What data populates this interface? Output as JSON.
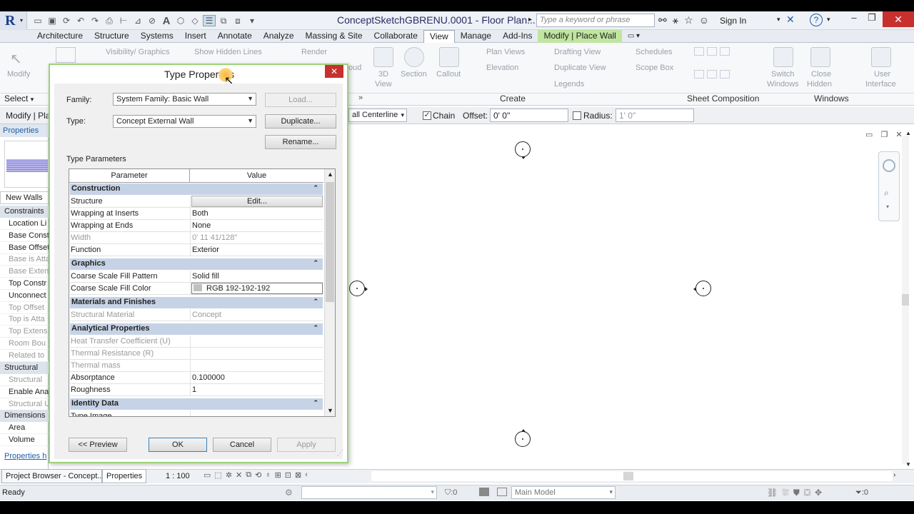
{
  "app": {
    "doc_title": "ConceptSketchGBRENU.0001 - Floor Plan...",
    "search_placeholder": "Type a keyword or phrase",
    "signin": "Sign In"
  },
  "tabs": [
    "Architecture",
    "Structure",
    "Systems",
    "Insert",
    "Annotate",
    "Analyze",
    "Massing & Site",
    "Collaborate",
    "View",
    "Manage",
    "Add-Ins",
    "Modify | Place Wall"
  ],
  "ribbon": {
    "modify": "Modify",
    "visibility": "Visibility/ Graphics",
    "hidden_lines": "Show  Hidden Lines",
    "render": "Render",
    "cloud": "oud",
    "view3d": "3D View",
    "view3d_line1": "3D",
    "view3d_line2": "View",
    "section": "Section",
    "callout": "Callout",
    "plan_views": "Plan Views",
    "elevation": "Elevation",
    "drafting_view": "Drafting  View",
    "duplicate_view": "Duplicate  View",
    "legends": "Legends",
    "schedules": "Schedules",
    "scope_box": "Scope  Box",
    "switch_windows": "Switch Windows",
    "switch_line1": "Switch",
    "switch_line2": "Windows",
    "close_hidden": "Close Hidden",
    "close_line1": "Close",
    "close_line2": "Hidden",
    "user_interface": "User Interface",
    "ui_line1": "User",
    "ui_line2": "Interface",
    "select": "Select",
    "panel_create": "Create",
    "panel_sheet": "Sheet Composition",
    "panel_windows": "Windows"
  },
  "optbar": {
    "modify_label": "Modify | Pla",
    "location_line": "all Centerline",
    "chain_label": "Chain",
    "chain_checked": true,
    "offset_label": "Offset:",
    "offset_value": "0'  0\"",
    "radius_label": "Radius:",
    "radius_value": "1'  0\""
  },
  "props": {
    "title": "Properties",
    "new_walls": "New Walls",
    "constraints": "Constraints",
    "rows": [
      "Location Li",
      "Base Const",
      "Base Offset",
      "Base is Atta",
      "Base Extens",
      "Top Constr",
      "Unconnect",
      "Top Offset",
      "Top is Atta",
      "Top Extens",
      "Room Bou",
      "Related to"
    ],
    "dim_rows": [
      false,
      false,
      false,
      true,
      true,
      false,
      false,
      true,
      true,
      true,
      true,
      true
    ],
    "structural": "Structural",
    "structural_rows": [
      "Structural",
      "Enable Ana",
      "Structural U"
    ],
    "structural_dim": [
      true,
      false,
      true
    ],
    "dimensions": "Dimensions",
    "dimension_rows": [
      "Area",
      "Volume"
    ],
    "help": "Properties h"
  },
  "dialog": {
    "title": "Type Properties",
    "family_label": "Family:",
    "family_value": "System Family: Basic Wall",
    "type_label": "Type:",
    "type_value": "Concept External Wall",
    "load": "Load...",
    "duplicate": "Duplicate...",
    "rename": "Rename...",
    "type_params": "Type Parameters",
    "col_param": "Parameter",
    "col_value": "Value",
    "groups": [
      {
        "name": "Construction",
        "rows": [
          {
            "p": "Structure",
            "v": "Edit...",
            "btn": true
          },
          {
            "p": "Wrapping at Inserts",
            "v": "Both"
          },
          {
            "p": "Wrapping at Ends",
            "v": "None"
          },
          {
            "p": "Width",
            "v": "0'  11 41/128\"",
            "dim": true
          },
          {
            "p": "Function",
            "v": "Exterior"
          }
        ]
      },
      {
        "name": "Graphics",
        "rows": [
          {
            "p": "Coarse Scale Fill Pattern",
            "v": "Solid fill"
          },
          {
            "p": "Coarse Scale Fill Color",
            "v": "RGB 192-192-192",
            "swatch": "#c0c0c0"
          }
        ]
      },
      {
        "name": "Materials and Finishes",
        "rows": [
          {
            "p": "Structural Material",
            "v": "Concept",
            "dim": true
          }
        ]
      },
      {
        "name": "Analytical Properties",
        "rows": [
          {
            "p": "Heat Transfer Coefficient (U)",
            "v": "",
            "dim": true
          },
          {
            "p": "Thermal Resistance (R)",
            "v": "",
            "dim": true
          },
          {
            "p": "Thermal mass",
            "v": "",
            "dim": true
          },
          {
            "p": "Absorptance",
            "v": "0.100000"
          },
          {
            "p": "Roughness",
            "v": "1"
          }
        ]
      },
      {
        "name": "Identity Data",
        "rows": [
          {
            "p": "Type Image",
            "v": ""
          }
        ]
      }
    ],
    "preview": "<< Preview",
    "ok": "OK",
    "cancel": "Cancel",
    "apply": "Apply"
  },
  "viewbar": {
    "project_browser": "Project Browser - Concept...",
    "properties_tab": "Properties",
    "scale": "1 : 100"
  },
  "status": {
    "text": "Ready",
    "sel_count": ":0",
    "main_model": "Main Model",
    "filter_count": ":0"
  },
  "colors": {
    "dialog_border": "#9bd27a",
    "group_header": "#c6d3e6",
    "context_tab": "#bfe5a0",
    "close_red": "#c8302d"
  }
}
